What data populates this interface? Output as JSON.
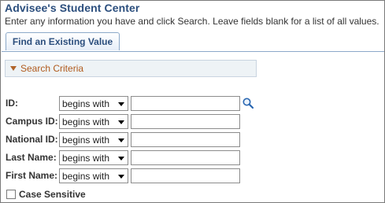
{
  "page": {
    "title": "Advisee's Student Center",
    "instructions": "Enter any information you have and click Search. Leave fields blank for a list of all values."
  },
  "tabs": [
    {
      "label": "Find an Existing Value"
    }
  ],
  "section": {
    "label": "Search Criteria"
  },
  "fields": [
    {
      "label": "ID:",
      "operator": "begins with",
      "value": "",
      "lookup_icon": "search-icon"
    },
    {
      "label": "Campus ID:",
      "operator": "begins with",
      "value": ""
    },
    {
      "label": "National ID:",
      "operator": "begins with",
      "value": ""
    },
    {
      "label": "Last Name:",
      "operator": "begins with",
      "value": ""
    },
    {
      "label": "First Name:",
      "operator": "begins with",
      "value": ""
    }
  ],
  "case_sensitive": {
    "label": "Case Sensitive",
    "checked": false
  },
  "colors": {
    "title": "#2b4e7d",
    "section_label": "#b05a1d",
    "section_background": "#eef3f6",
    "tab_border": "#8ca9c9"
  }
}
